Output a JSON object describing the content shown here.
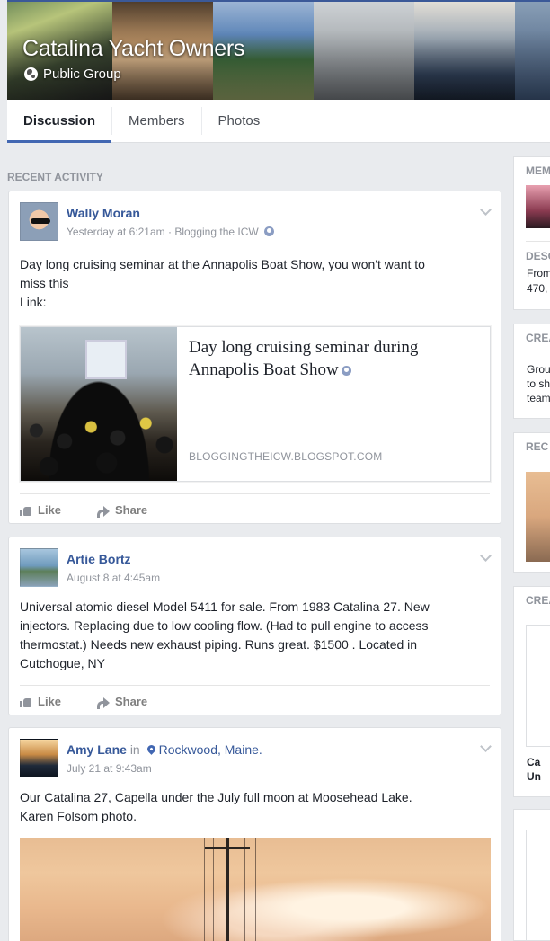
{
  "group": {
    "name": "Catalina Yacht Owners",
    "privacy": "Public Group"
  },
  "tabs": [
    "Discussion",
    "Members",
    "Photos"
  ],
  "section_label": "RECENT ACTIVITY",
  "posts": [
    {
      "author": "Wally Moran",
      "time": "Yesterday at 6:21am",
      "via": "Blogging the ICW",
      "text_line1": "Day long cruising seminar at the Annapolis Boat Show, you won't want to",
      "text_line2": "miss this",
      "text_line3": "Link:",
      "link": {
        "title_line1": "Day long cruising seminar during",
        "title_line2": "Annapolis Boat Show",
        "domain": "BLOGGINGTHEICW.BLOGSPOT.COM"
      },
      "like_label": "Like",
      "share_label": "Share"
    },
    {
      "author": "Artie Bortz",
      "time": "August 8 at 4:45am",
      "text_line1": "Universal atomic diesel Model 5411 for sale. From 1983 Catalina 27. New",
      "text_line2": "injectors. Replacing due to low cooling flow. (Had to pull engine to access",
      "text_line3": "thermostat.) Needs new exhaust piping. Runs great. $1500 . Located in",
      "text_line4": "Cutchogue, NY",
      "like_label": "Like",
      "share_label": "Share"
    },
    {
      "author": "Amy Lane",
      "in": "in",
      "location": "Rockwood, Maine.",
      "time": "July 21 at 9:43am",
      "text_line1": "Our Catalina 27, Capella under the July full moon at Moosehead Lake.",
      "text_line2": "Karen Folsom photo."
    }
  ],
  "right_column": {
    "members_label": "MEM",
    "desc_label": "DESC",
    "desc_line1": "From",
    "desc_line2": "470,",
    "create_label": "CREA",
    "create_line1": "Grou",
    "create_line2": "to sh",
    "create_line3": "team",
    "recent_label": "REC",
    "create2_label": "CREA",
    "card_line1": "Ca",
    "card_line2": "Un"
  }
}
